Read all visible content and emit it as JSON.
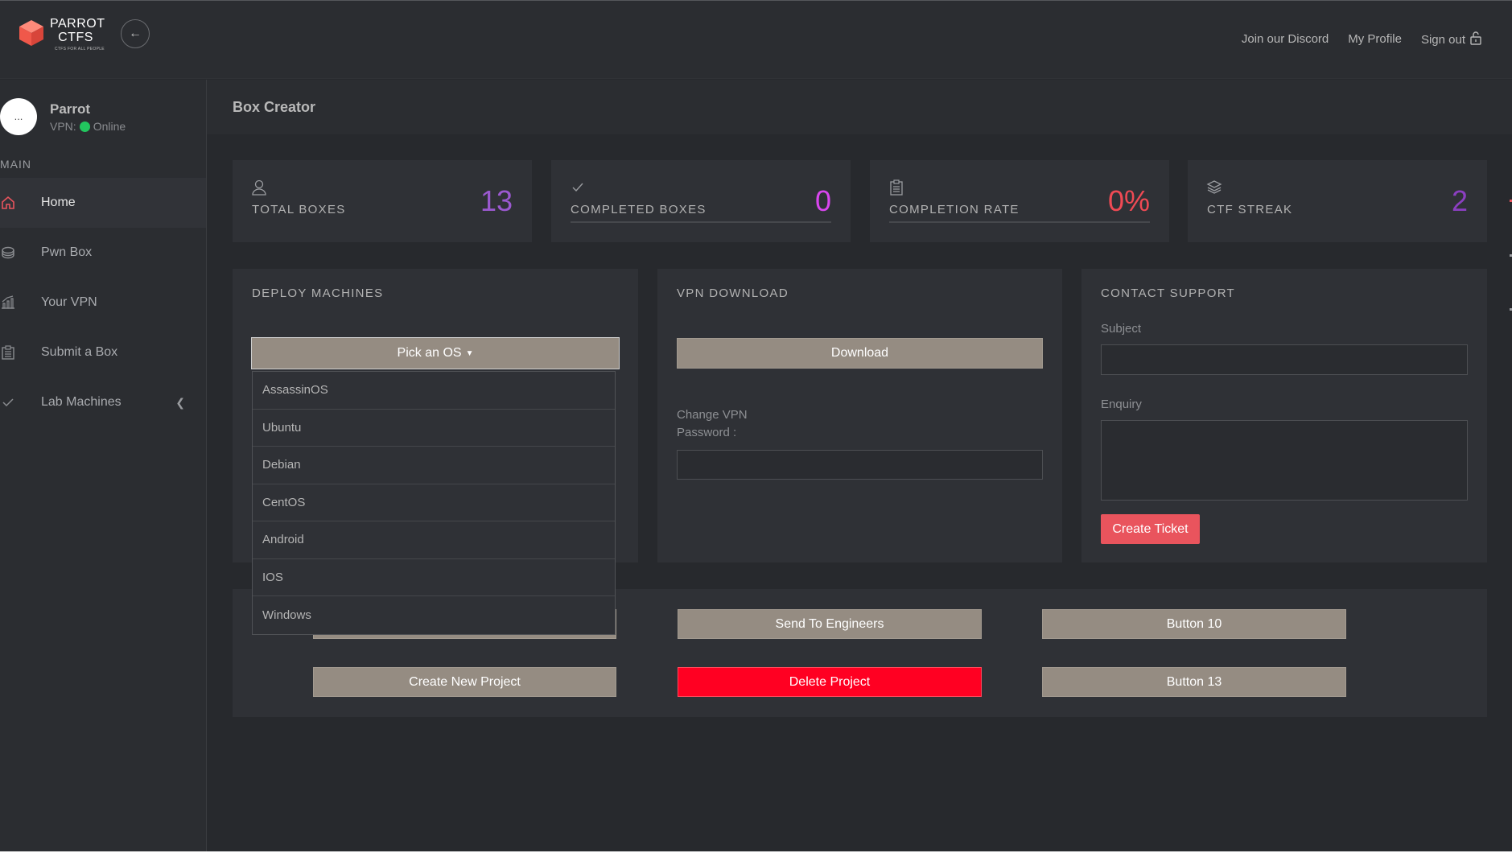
{
  "brand": {
    "name": "PARROT CTFS",
    "tagline": "CTFS FOR ALL PEOPLE",
    "accent": "#e9545d"
  },
  "topnav": {
    "discord": "Join our Discord",
    "profile": "My Profile",
    "signout": "Sign out"
  },
  "user": {
    "avatar_text": "...",
    "name": "Parrot",
    "vpn_label": "VPN:",
    "vpn_status": "Online",
    "status_color": "#22c55e"
  },
  "sidebar": {
    "section": "MAIN",
    "items": [
      {
        "label": "Home",
        "icon": "home-icon",
        "active": true
      },
      {
        "label": "Pwn Box",
        "icon": "box-icon"
      },
      {
        "label": "Your VPN",
        "icon": "chart-icon"
      },
      {
        "label": "Submit a Box",
        "icon": "clipboard-icon"
      },
      {
        "label": "Lab Machines",
        "icon": "check-icon"
      }
    ]
  },
  "page": {
    "title": "Box Creator"
  },
  "stats": [
    {
      "label": "TOTAL BOXES",
      "value": "13",
      "icon": "user-icon",
      "color": "#9b59d0"
    },
    {
      "label": "COMPLETED BOXES",
      "value": "0",
      "icon": "check-icon",
      "color": "#d946ef"
    },
    {
      "label": "COMPLETION RATE",
      "value": "0%",
      "icon": "clipboard-icon",
      "color": "#ef4a54"
    },
    {
      "label": "CTF STREAK",
      "value": "2",
      "icon": "layers-icon",
      "color": "#8b3fc0"
    }
  ],
  "deploy": {
    "title": "DEPLOY MACHINES",
    "pick_label": "Pick an OS",
    "os_options": [
      "AssassinOS",
      "Ubuntu",
      "Debian",
      "CentOS",
      "Android",
      "IOS",
      "Windows"
    ]
  },
  "vpn": {
    "title": "VPN DOWNLOAD",
    "download_label": "Download",
    "change_label_line1": "Change VPN",
    "change_label_line2": "Password :",
    "password_value": ""
  },
  "support": {
    "title": "CONTACT SUPPORT",
    "subject_label": "Subject",
    "subject_value": "",
    "enquiry_label": "Enquiry",
    "enquiry_value": "",
    "ticket_label": "Create Ticket"
  },
  "actions": {
    "send": "Send To Engineers",
    "button10": "Button 10",
    "create": "Create New Project",
    "delete": "Delete Project",
    "button13": "Button 13"
  }
}
